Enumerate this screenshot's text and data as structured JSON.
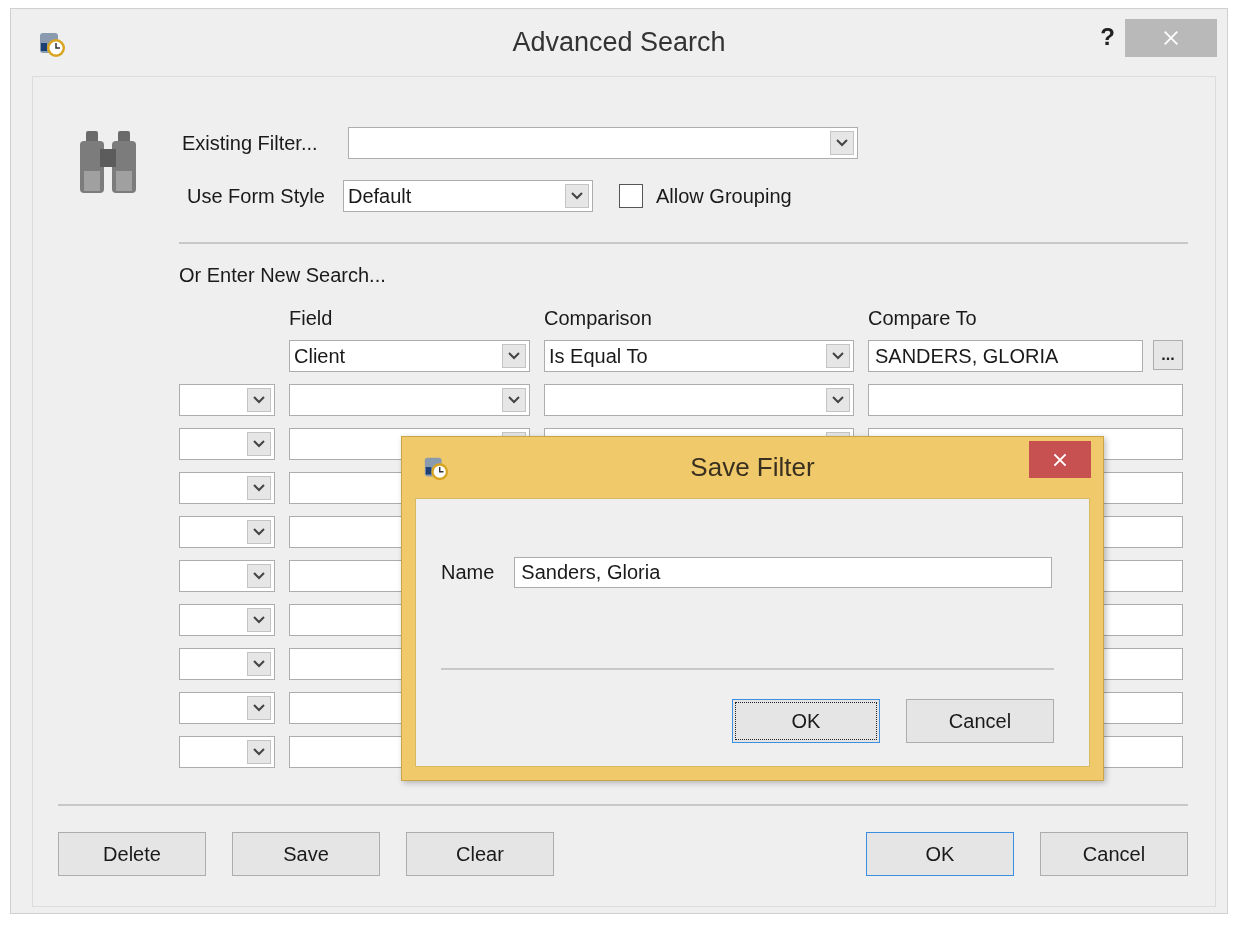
{
  "window": {
    "title": "Advanced Search",
    "help": "?"
  },
  "existing_filter": {
    "label": "Existing Filter..."
  },
  "form_style": {
    "label": "Use Form Style",
    "value": "Default"
  },
  "allow_grouping": {
    "label": "Allow Grouping",
    "checked": false
  },
  "new_search": {
    "label": "Or Enter New Search...",
    "columns": [
      "Field",
      "Comparison",
      "Compare To"
    ],
    "browse": "...",
    "rows": [
      {
        "kind": "first",
        "field": "Client",
        "comparison": "Is Equal To",
        "compare_to": "SANDERS, GLORIA"
      },
      {
        "kind": "joined"
      },
      {
        "kind": "joined"
      },
      {
        "kind": "covered"
      },
      {
        "kind": "covered"
      },
      {
        "kind": "covered"
      },
      {
        "kind": "covered"
      },
      {
        "kind": "covered"
      },
      {
        "kind": "covered"
      },
      {
        "kind": "covered"
      }
    ]
  },
  "left_buttons": [
    {
      "label": "Delete",
      "default": false
    },
    {
      "label": "Save",
      "default": false
    },
    {
      "label": "Clear",
      "default": false
    }
  ],
  "right_buttons": [
    {
      "label": "OK",
      "default": true
    },
    {
      "label": "Cancel",
      "default": false
    }
  ],
  "save_filter": {
    "title": "Save Filter",
    "name_label": "Name",
    "name_value": "Sanders, Gloria",
    "buttons": [
      {
        "label": "OK",
        "default": true
      },
      {
        "label": "Cancel",
        "default": false
      }
    ]
  }
}
